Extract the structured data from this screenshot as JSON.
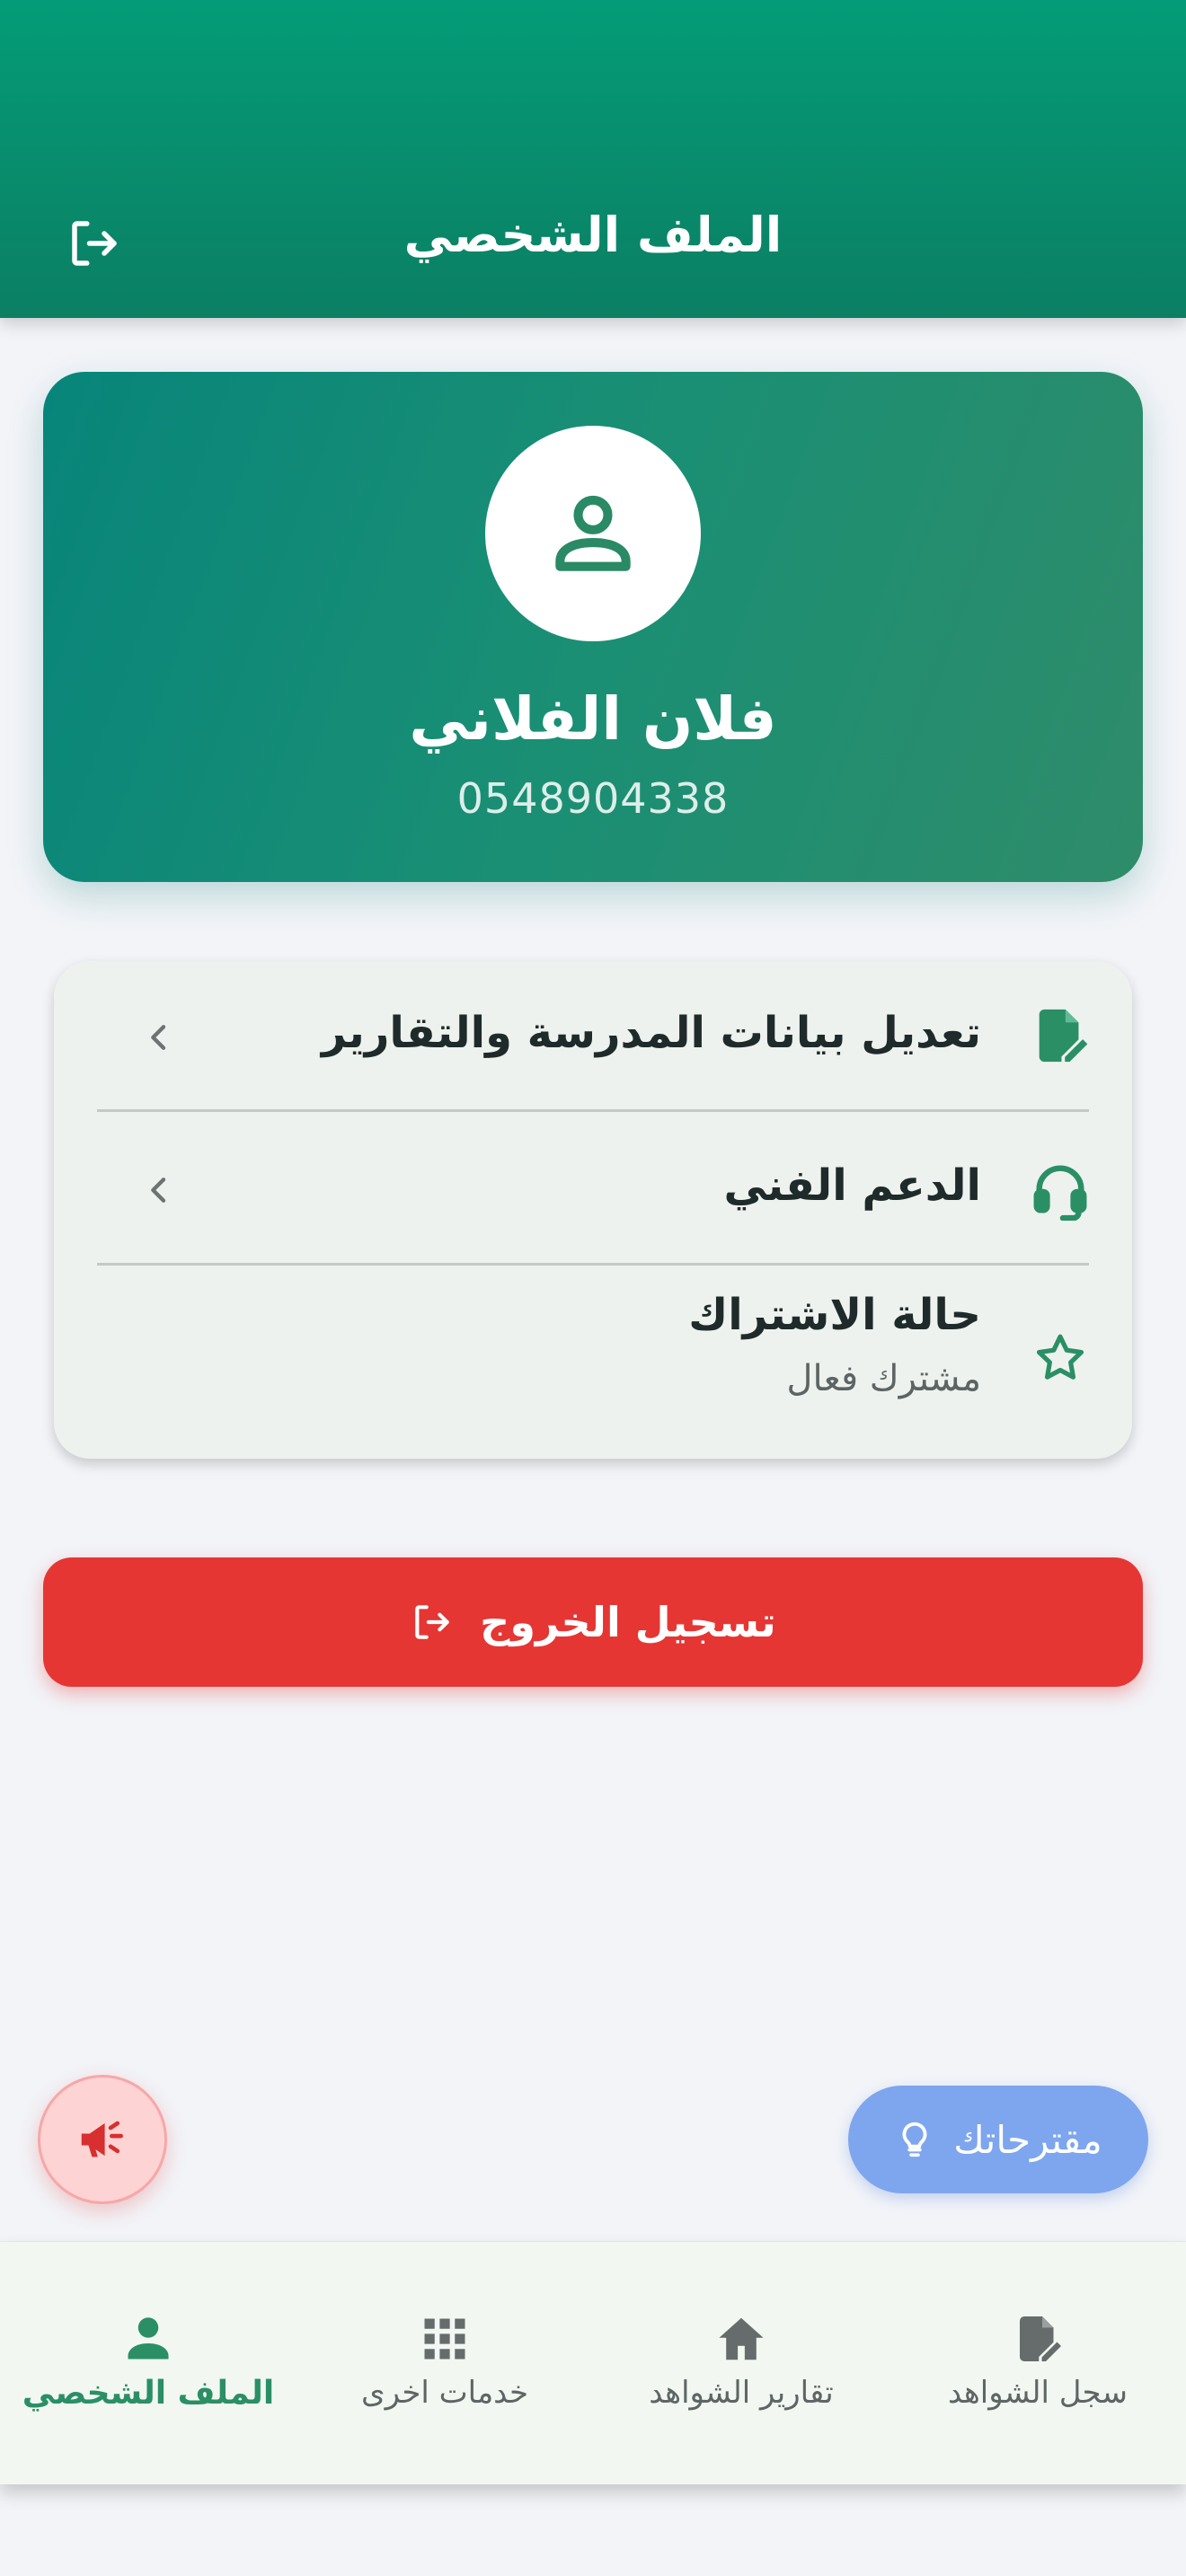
{
  "header": {
    "title": "الملف الشخصي",
    "logout_icon": "logout-icon"
  },
  "profile": {
    "name": "فلان الفلاني",
    "phone": "0548904338",
    "avatar_icon": "person-icon"
  },
  "menu": {
    "items": [
      {
        "label": "تعديل بيانات المدرسة والتقارير",
        "icon": "edit-document-icon",
        "has_chevron": true
      },
      {
        "label": "الدعم الفني",
        "icon": "headset-icon",
        "has_chevron": true
      },
      {
        "label": "حالة الاشتراك",
        "sublabel": "مشترك فعال",
        "icon": "star-icon",
        "has_chevron": false
      }
    ]
  },
  "logout_button": {
    "label": "تسجيل الخروج",
    "icon": "logout-icon"
  },
  "suggestions_button": {
    "label": "مقترحاتك",
    "icon": "lightbulb-icon"
  },
  "announce_button": {
    "icon": "megaphone-icon"
  },
  "bottom_nav": {
    "items": [
      {
        "label": "سجل الشواهد",
        "icon": "edit-document-icon",
        "active": false
      },
      {
        "label": "تقارير الشواهد",
        "icon": "home-icon",
        "active": false
      },
      {
        "label": "خدمات اخرى",
        "icon": "apps-grid-icon",
        "active": false
      },
      {
        "label": "الملف الشخصي",
        "icon": "person-icon",
        "active": true
      }
    ]
  },
  "colors": {
    "primary": "#0b8a6a",
    "accent": "#2a8f65",
    "danger": "#e53634",
    "suggest": "#7ea6ee",
    "background": "#f2f4f8"
  }
}
